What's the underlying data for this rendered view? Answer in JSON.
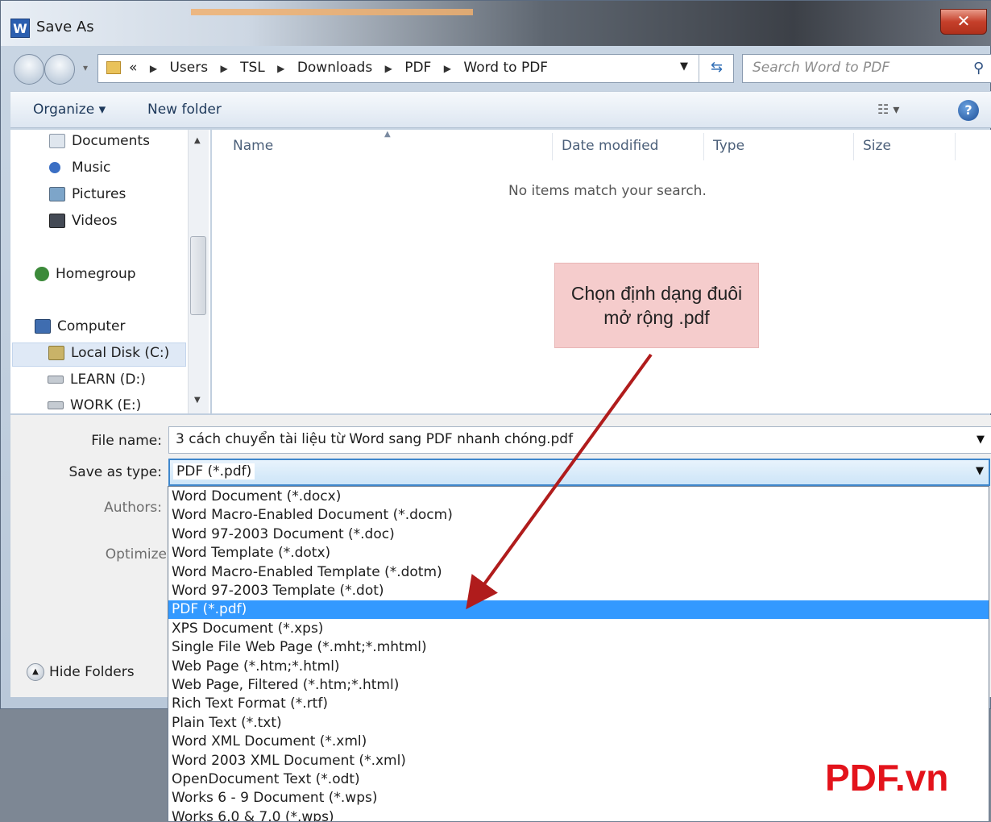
{
  "window": {
    "title": "Save As",
    "app_icon": "W",
    "close_glyph": "✕"
  },
  "address": {
    "prefix": "«",
    "crumbs": [
      "Users",
      "TSL",
      "Downloads",
      "PDF",
      "Word to PDF"
    ],
    "search_placeholder": "Search Word to PDF"
  },
  "toolbar": {
    "organize_label": "Organize ▾",
    "new_folder_label": "New folder",
    "views_label": "☷ ▾",
    "help_label": "?"
  },
  "sidebar": {
    "items": [
      {
        "label": "Documents",
        "icon": "documents-icon",
        "color": "#dfe6ee"
      },
      {
        "label": "Music",
        "icon": "music-icon",
        "color": "#3b6fc4"
      },
      {
        "label": "Pictures",
        "icon": "pictures-icon",
        "color": "#7da5c9"
      },
      {
        "label": "Videos",
        "icon": "videos-icon",
        "color": "#444a55"
      },
      {
        "label": "Homegroup",
        "icon": "homegroup-icon",
        "color": "#3c8a3a"
      },
      {
        "label": "Computer",
        "icon": "computer-icon",
        "color": "#3f6db0"
      },
      {
        "label": "Local Disk (C:)",
        "icon": "local-disk-icon",
        "color": "#c9b368"
      },
      {
        "label": "LEARN (D:)",
        "icon": "drive-icon",
        "color": "#c5cbd2"
      },
      {
        "label": "WORK (E:)",
        "icon": "drive-icon",
        "color": "#c5cbd2"
      }
    ]
  },
  "filelist": {
    "columns": [
      "Name",
      "Date modified",
      "Type",
      "Size"
    ],
    "empty_message": "No items match your search."
  },
  "callout": {
    "line1": "Chọn định dạng đuôi",
    "line2": "mở rộng .pdf"
  },
  "form": {
    "file_name_label": "File name:",
    "file_name_value": "3 cách chuyển tài liệu từ Word sang PDF nhanh chóng.pdf",
    "save_type_label": "Save as type:",
    "save_type_value": "PDF (*.pdf)",
    "authors_label": "Authors:",
    "optimize_label": "Optimize",
    "hide_folders_label": "Hide Folders"
  },
  "type_options": [
    "Word Document (*.docx)",
    "Word Macro-Enabled Document (*.docm)",
    "Word 97-2003 Document (*.doc)",
    "Word Template (*.dotx)",
    "Word Macro-Enabled Template (*.dotm)",
    "Word 97-2003 Template (*.dot)",
    "PDF (*.pdf)",
    "XPS Document (*.xps)",
    "Single File Web Page (*.mht;*.mhtml)",
    "Web Page (*.htm;*.html)",
    "Web Page, Filtered (*.htm;*.html)",
    "Rich Text Format (*.rtf)",
    "Plain Text (*.txt)",
    "Word XML Document (*.xml)",
    "Word 2003 XML Document (*.xml)",
    "OpenDocument Text (*.odt)",
    "Works 6 - 9 Document (*.wps)",
    "Works 6.0 & 7.0 (*.wps)"
  ],
  "selected_option_index": 6,
  "watermark": "PDF.vn",
  "colors": {
    "accent": "#3399ff",
    "callout_bg": "#f5cccc",
    "arrow": "#b01c1c",
    "watermark": "#e3131b"
  }
}
